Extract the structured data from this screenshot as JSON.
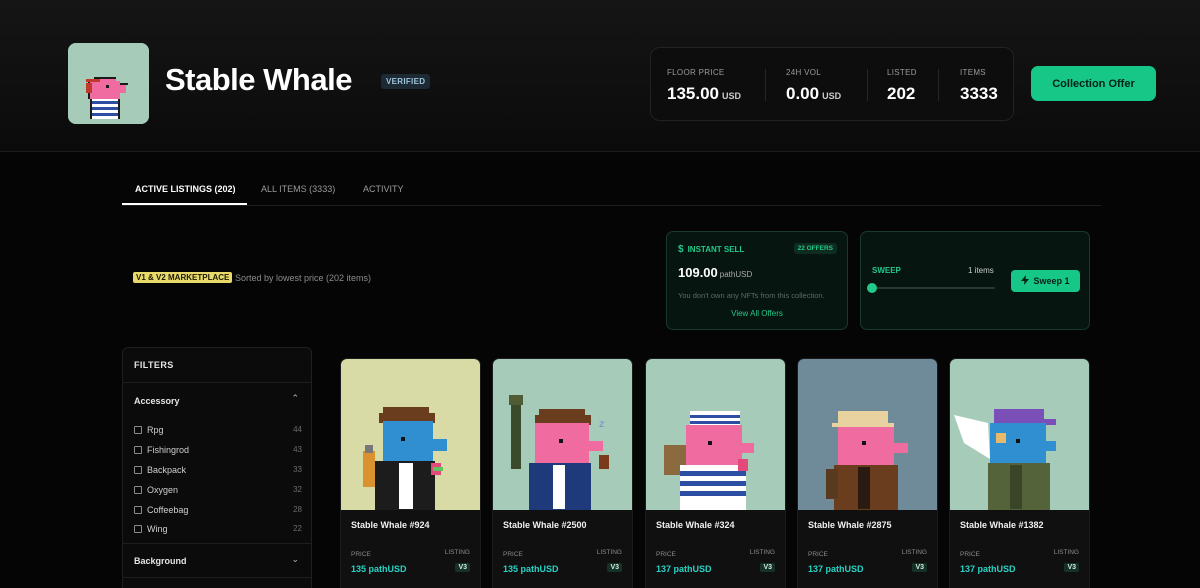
{
  "header": {
    "title": "Stable Whale",
    "verified": "VERIFIED",
    "collection_offer": "Collection Offer"
  },
  "stats": {
    "floor_label": "FLOOR PRICE",
    "floor_value": "135.00",
    "floor_unit": "USD",
    "vol_label": "24H VOL",
    "vol_value": "0.00",
    "vol_unit": "USD",
    "listed_label": "LISTED",
    "listed_value": "202",
    "items_label": "ITEMS",
    "items_value": "3333"
  },
  "tabs": [
    {
      "label": "ACTIVE LISTINGS (202)"
    },
    {
      "label": "ALL ITEMS (3333)"
    },
    {
      "label": "ACTIVITY"
    }
  ],
  "marketplace": {
    "badge": "V1 & V2 MARKETPLACE",
    "sort_text": "Sorted by lowest price (202 items)"
  },
  "instant_sell": {
    "title": "INSTANT SELL",
    "offers_badge": "22 OFFERS",
    "price": "109.00",
    "unit": "pathUSD",
    "note": "You don't own any NFTs from this collection.",
    "view_all": "View All Offers",
    "icon": "dollar-icon"
  },
  "sweep": {
    "title": "SWEEP",
    "count": "1 items",
    "button": "Sweep 1",
    "icon": "bolt-icon"
  },
  "filters": {
    "title": "FILTERS",
    "sections": [
      {
        "name": "Accessory",
        "items": [
          {
            "label": "Rpg",
            "count": "44"
          },
          {
            "label": "Fishingrod",
            "count": "43"
          },
          {
            "label": "Backpack",
            "count": "33"
          },
          {
            "label": "Oxygen",
            "count": "32"
          },
          {
            "label": "Coffeebag",
            "count": "28"
          },
          {
            "label": "Wing",
            "count": "22"
          }
        ]
      },
      {
        "name": "Background"
      }
    ]
  },
  "cards": [
    {
      "name": "Stable Whale #924",
      "price_label": "PRICE",
      "listing_label": "LISTING",
      "price": "135 pathUSD",
      "version": "V3",
      "bg": "#d9dba6"
    },
    {
      "name": "Stable Whale #2500",
      "price_label": "PRICE",
      "listing_label": "LISTING",
      "price": "135 pathUSD",
      "version": "V3",
      "bg": "#a6cbb9"
    },
    {
      "name": "Stable Whale #324",
      "price_label": "PRICE",
      "listing_label": "LISTING",
      "price": "137 pathUSD",
      "version": "V3",
      "bg": "#a6cbb9"
    },
    {
      "name": "Stable Whale #2875",
      "price_label": "PRICE",
      "listing_label": "LISTING",
      "price": "137 pathUSD",
      "version": "V3",
      "bg": "#6f8b9a"
    },
    {
      "name": "Stable Whale #1382",
      "price_label": "PRICE",
      "listing_label": "LISTING",
      "price": "137 pathUSD",
      "version": "V3",
      "bg": "#a6cbb9"
    }
  ],
  "colors": {
    "accent": "#16c788",
    "price_text": "#28d3c6",
    "badge_yellow": "#e8d96a"
  }
}
